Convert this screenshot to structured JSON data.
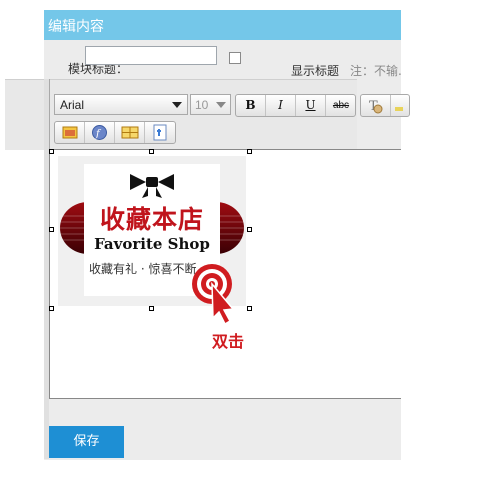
{
  "panel": {
    "title": "编辑内容"
  },
  "form": {
    "module_title_label": "模块标题：",
    "module_title_value": "",
    "show_title_label": "显示标题",
    "show_title_checked": false,
    "note": "注：不输."
  },
  "toolbar": {
    "font_family": "Arial",
    "font_size": "10",
    "bold_label": "B",
    "italic_label": "I",
    "underline_label": "U",
    "strike_label": "abc",
    "row1_icons": [
      "text-color-icon",
      "highlight-icon"
    ],
    "row2_icons": [
      "insert-image-icon",
      "insert-flash-icon",
      "insert-table-icon",
      "insert-media-icon"
    ]
  },
  "content_image": {
    "headline": "收藏本店",
    "subtitle": "Favorite Shop",
    "tagline": "收藏有礼 · 惊喜不断",
    "accent_color": "#c0141c"
  },
  "annotation": {
    "label": "双击"
  },
  "actions": {
    "save_label": "保存"
  }
}
